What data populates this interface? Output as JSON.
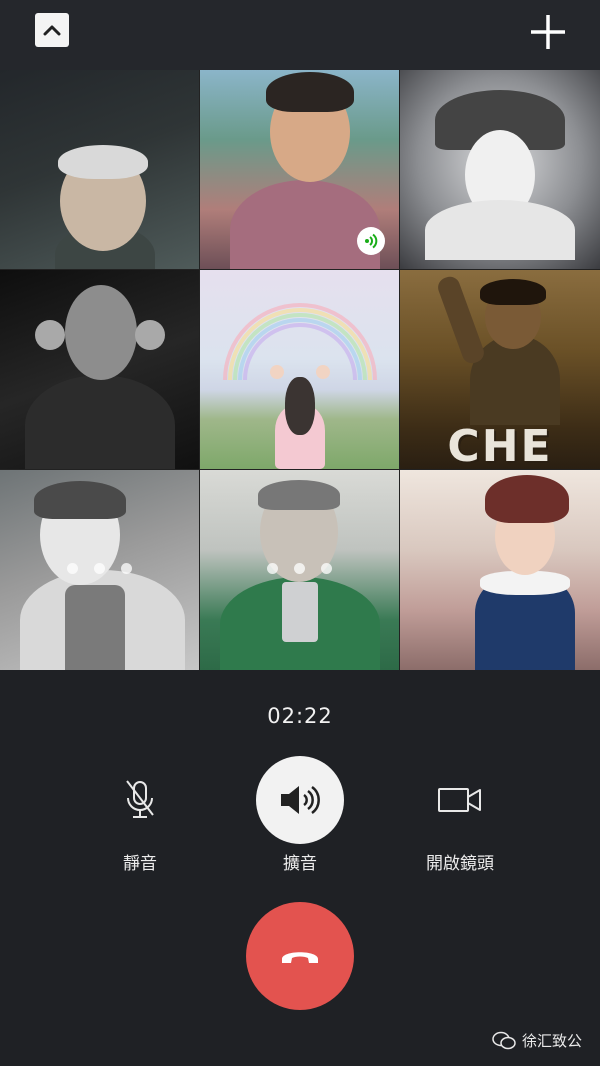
{
  "header": {
    "collapse_icon": "chevron-up-icon",
    "add_icon": "plus-icon"
  },
  "participants": [
    {
      "id": "p1",
      "kind": "photo"
    },
    {
      "id": "p2",
      "kind": "photo",
      "speaking": true
    },
    {
      "id": "p3",
      "kind": "photo"
    },
    {
      "id": "p4",
      "kind": "photo"
    },
    {
      "id": "p5",
      "kind": "photo"
    },
    {
      "id": "p6",
      "kind": "photo",
      "overlay_text": "CHE"
    },
    {
      "id": "p7",
      "kind": "photo",
      "connecting": true
    },
    {
      "id": "p8",
      "kind": "photo",
      "connecting": true
    },
    {
      "id": "p9",
      "kind": "photo"
    }
  ],
  "call": {
    "timer": "02:22"
  },
  "controls": {
    "mute_label": "靜音",
    "speaker_label": "擴音",
    "camera_label": "開啟鏡頭"
  },
  "watermark": {
    "text": "徐汇致公"
  },
  "colors": {
    "background": "#1f2125",
    "hangup": "#e3534f",
    "speaking": "#1aad19"
  }
}
